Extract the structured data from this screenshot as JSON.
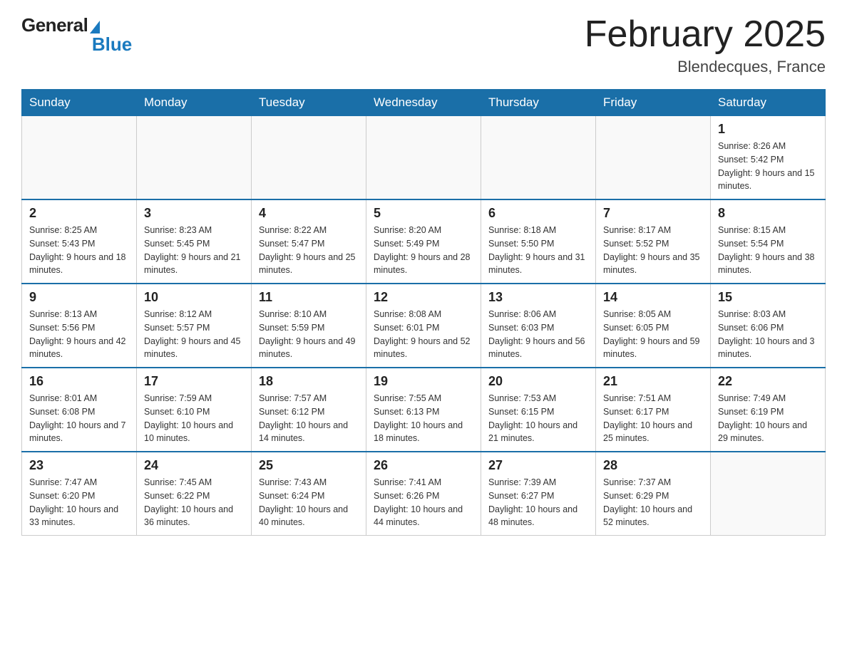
{
  "header": {
    "logo_general": "General",
    "logo_blue": "Blue",
    "month_title": "February 2025",
    "location": "Blendecques, France"
  },
  "days_of_week": [
    "Sunday",
    "Monday",
    "Tuesday",
    "Wednesday",
    "Thursday",
    "Friday",
    "Saturday"
  ],
  "weeks": [
    [
      {
        "day": "",
        "info": ""
      },
      {
        "day": "",
        "info": ""
      },
      {
        "day": "",
        "info": ""
      },
      {
        "day": "",
        "info": ""
      },
      {
        "day": "",
        "info": ""
      },
      {
        "day": "",
        "info": ""
      },
      {
        "day": "1",
        "info": "Sunrise: 8:26 AM\nSunset: 5:42 PM\nDaylight: 9 hours and 15 minutes."
      }
    ],
    [
      {
        "day": "2",
        "info": "Sunrise: 8:25 AM\nSunset: 5:43 PM\nDaylight: 9 hours and 18 minutes."
      },
      {
        "day": "3",
        "info": "Sunrise: 8:23 AM\nSunset: 5:45 PM\nDaylight: 9 hours and 21 minutes."
      },
      {
        "day": "4",
        "info": "Sunrise: 8:22 AM\nSunset: 5:47 PM\nDaylight: 9 hours and 25 minutes."
      },
      {
        "day": "5",
        "info": "Sunrise: 8:20 AM\nSunset: 5:49 PM\nDaylight: 9 hours and 28 minutes."
      },
      {
        "day": "6",
        "info": "Sunrise: 8:18 AM\nSunset: 5:50 PM\nDaylight: 9 hours and 31 minutes."
      },
      {
        "day": "7",
        "info": "Sunrise: 8:17 AM\nSunset: 5:52 PM\nDaylight: 9 hours and 35 minutes."
      },
      {
        "day": "8",
        "info": "Sunrise: 8:15 AM\nSunset: 5:54 PM\nDaylight: 9 hours and 38 minutes."
      }
    ],
    [
      {
        "day": "9",
        "info": "Sunrise: 8:13 AM\nSunset: 5:56 PM\nDaylight: 9 hours and 42 minutes."
      },
      {
        "day": "10",
        "info": "Sunrise: 8:12 AM\nSunset: 5:57 PM\nDaylight: 9 hours and 45 minutes."
      },
      {
        "day": "11",
        "info": "Sunrise: 8:10 AM\nSunset: 5:59 PM\nDaylight: 9 hours and 49 minutes."
      },
      {
        "day": "12",
        "info": "Sunrise: 8:08 AM\nSunset: 6:01 PM\nDaylight: 9 hours and 52 minutes."
      },
      {
        "day": "13",
        "info": "Sunrise: 8:06 AM\nSunset: 6:03 PM\nDaylight: 9 hours and 56 minutes."
      },
      {
        "day": "14",
        "info": "Sunrise: 8:05 AM\nSunset: 6:05 PM\nDaylight: 9 hours and 59 minutes."
      },
      {
        "day": "15",
        "info": "Sunrise: 8:03 AM\nSunset: 6:06 PM\nDaylight: 10 hours and 3 minutes."
      }
    ],
    [
      {
        "day": "16",
        "info": "Sunrise: 8:01 AM\nSunset: 6:08 PM\nDaylight: 10 hours and 7 minutes."
      },
      {
        "day": "17",
        "info": "Sunrise: 7:59 AM\nSunset: 6:10 PM\nDaylight: 10 hours and 10 minutes."
      },
      {
        "day": "18",
        "info": "Sunrise: 7:57 AM\nSunset: 6:12 PM\nDaylight: 10 hours and 14 minutes."
      },
      {
        "day": "19",
        "info": "Sunrise: 7:55 AM\nSunset: 6:13 PM\nDaylight: 10 hours and 18 minutes."
      },
      {
        "day": "20",
        "info": "Sunrise: 7:53 AM\nSunset: 6:15 PM\nDaylight: 10 hours and 21 minutes."
      },
      {
        "day": "21",
        "info": "Sunrise: 7:51 AM\nSunset: 6:17 PM\nDaylight: 10 hours and 25 minutes."
      },
      {
        "day": "22",
        "info": "Sunrise: 7:49 AM\nSunset: 6:19 PM\nDaylight: 10 hours and 29 minutes."
      }
    ],
    [
      {
        "day": "23",
        "info": "Sunrise: 7:47 AM\nSunset: 6:20 PM\nDaylight: 10 hours and 33 minutes."
      },
      {
        "day": "24",
        "info": "Sunrise: 7:45 AM\nSunset: 6:22 PM\nDaylight: 10 hours and 36 minutes."
      },
      {
        "day": "25",
        "info": "Sunrise: 7:43 AM\nSunset: 6:24 PM\nDaylight: 10 hours and 40 minutes."
      },
      {
        "day": "26",
        "info": "Sunrise: 7:41 AM\nSunset: 6:26 PM\nDaylight: 10 hours and 44 minutes."
      },
      {
        "day": "27",
        "info": "Sunrise: 7:39 AM\nSunset: 6:27 PM\nDaylight: 10 hours and 48 minutes."
      },
      {
        "day": "28",
        "info": "Sunrise: 7:37 AM\nSunset: 6:29 PM\nDaylight: 10 hours and 52 minutes."
      },
      {
        "day": "",
        "info": ""
      }
    ]
  ]
}
